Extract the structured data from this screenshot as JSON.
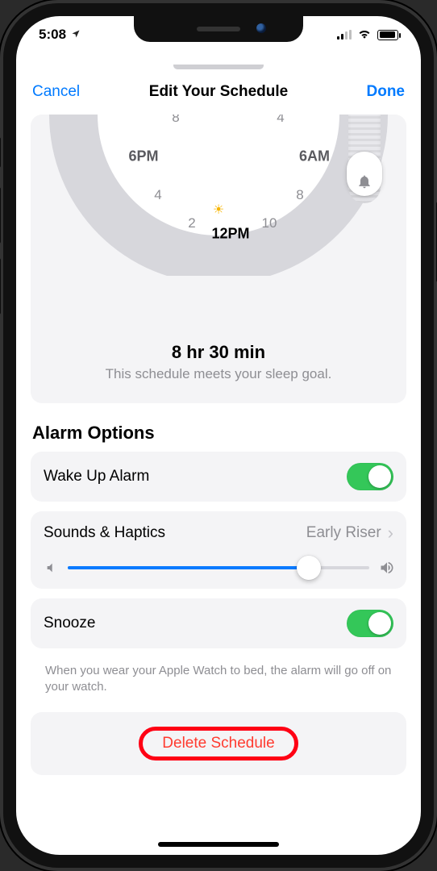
{
  "status": {
    "time": "5:08"
  },
  "sheet": {
    "cancel": "Cancel",
    "title": "Edit Your Schedule",
    "done": "Done"
  },
  "clock": {
    "labels": {
      "h8a": "8",
      "h4a": "4",
      "h6pm": "6PM",
      "h6am": "6AM",
      "h4b": "4",
      "h8b": "8",
      "h2": "2",
      "h12pm": "12PM",
      "h10": "10"
    },
    "duration_title": "8 hr 30 min",
    "duration_sub": "This schedule meets your sleep goal."
  },
  "alarm": {
    "section_title": "Alarm Options",
    "wake_label": "Wake Up Alarm",
    "sounds_label": "Sounds & Haptics",
    "sounds_value": "Early Riser",
    "volume_percent": 80,
    "snooze_label": "Snooze",
    "footer_note": "When you wear your Apple Watch to bed, the alarm will go off on your watch."
  },
  "delete": {
    "label": "Delete Schedule"
  }
}
